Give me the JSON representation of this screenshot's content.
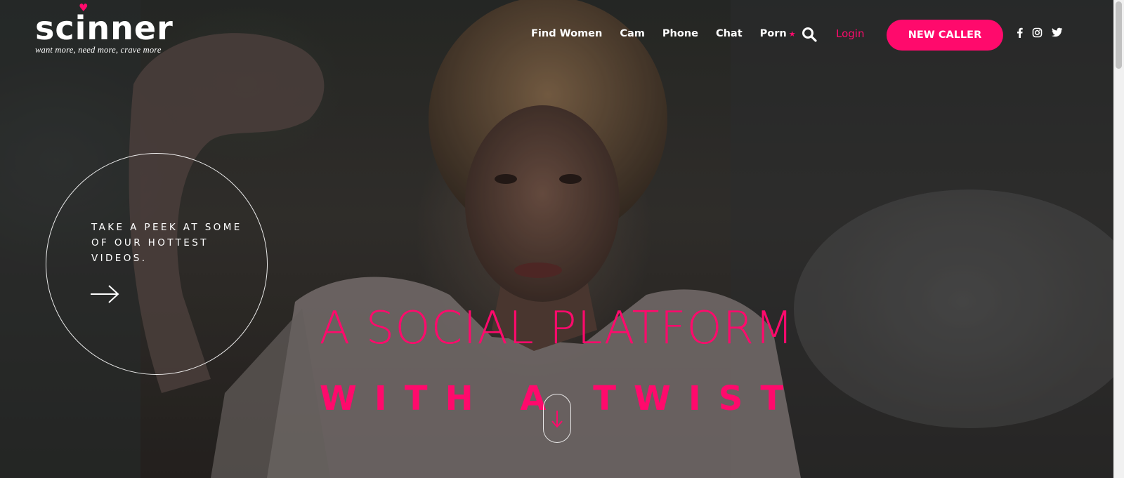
{
  "brand": {
    "name": "scinner",
    "tagline": "want more, need more, crave more",
    "accent_color": "#ff0a6c"
  },
  "nav": {
    "items": [
      {
        "label": "Find Women"
      },
      {
        "label": "Cam"
      },
      {
        "label": "Phone"
      },
      {
        "label": "Chat"
      },
      {
        "label": "Porn",
        "badge_icon": "star-icon"
      }
    ],
    "search_icon": "search-icon",
    "login_label": "Login",
    "cta_label": "NEW CALLER"
  },
  "social": [
    "facebook-icon",
    "instagram-icon",
    "twitter-icon"
  ],
  "hero": {
    "peek_text": "TAKE A PEEK AT SOME OF OUR HOTTEST VIDEOS.",
    "peek_icon": "arrow-right-icon",
    "headline": "A SOCIAL PLATFORM",
    "subheadline": "WITH A TWIST",
    "scroll_icon": "arrow-down-icon"
  }
}
